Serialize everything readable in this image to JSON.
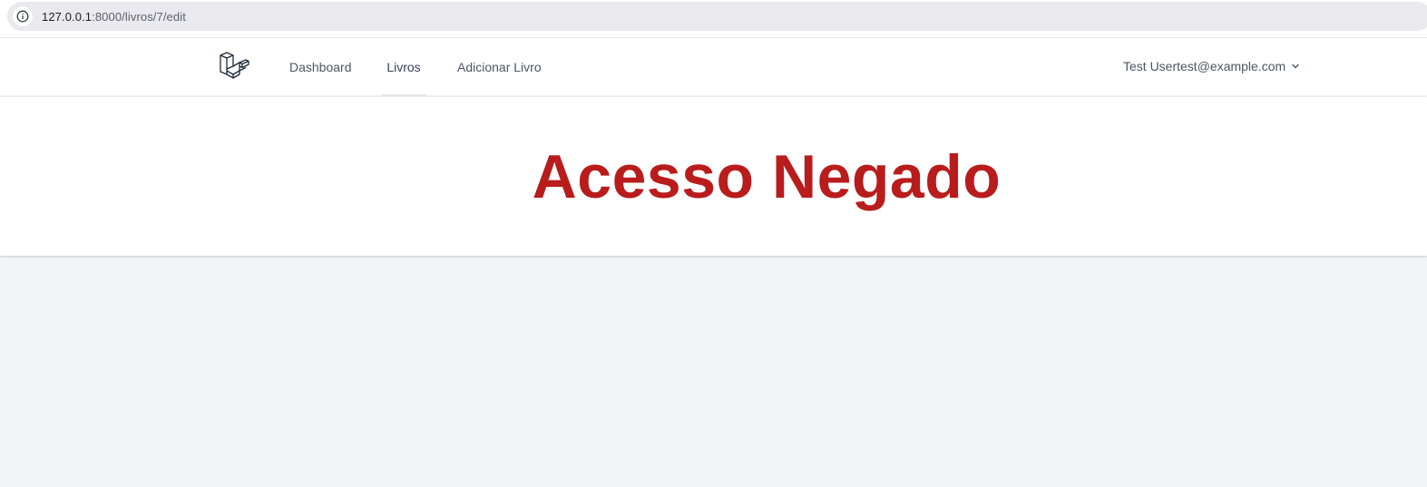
{
  "browser": {
    "url_host": "127.0.0.1",
    "url_rest": ":8000/livros/7/edit"
  },
  "navbar": {
    "logo_icon": "laravel-logo-icon",
    "links": [
      {
        "label": "Dashboard"
      },
      {
        "label": "Livros",
        "active": true
      },
      {
        "label": "Adicionar Livro"
      }
    ],
    "user": {
      "label": "Test Usertest@example.com",
      "icon": "chevron-down-icon"
    }
  },
  "header": {
    "title": "Acesso Negado",
    "title_color": "#b91c1c"
  },
  "colors": {
    "page_background": "#f3f4f6",
    "nav_text": "#4b5563"
  }
}
